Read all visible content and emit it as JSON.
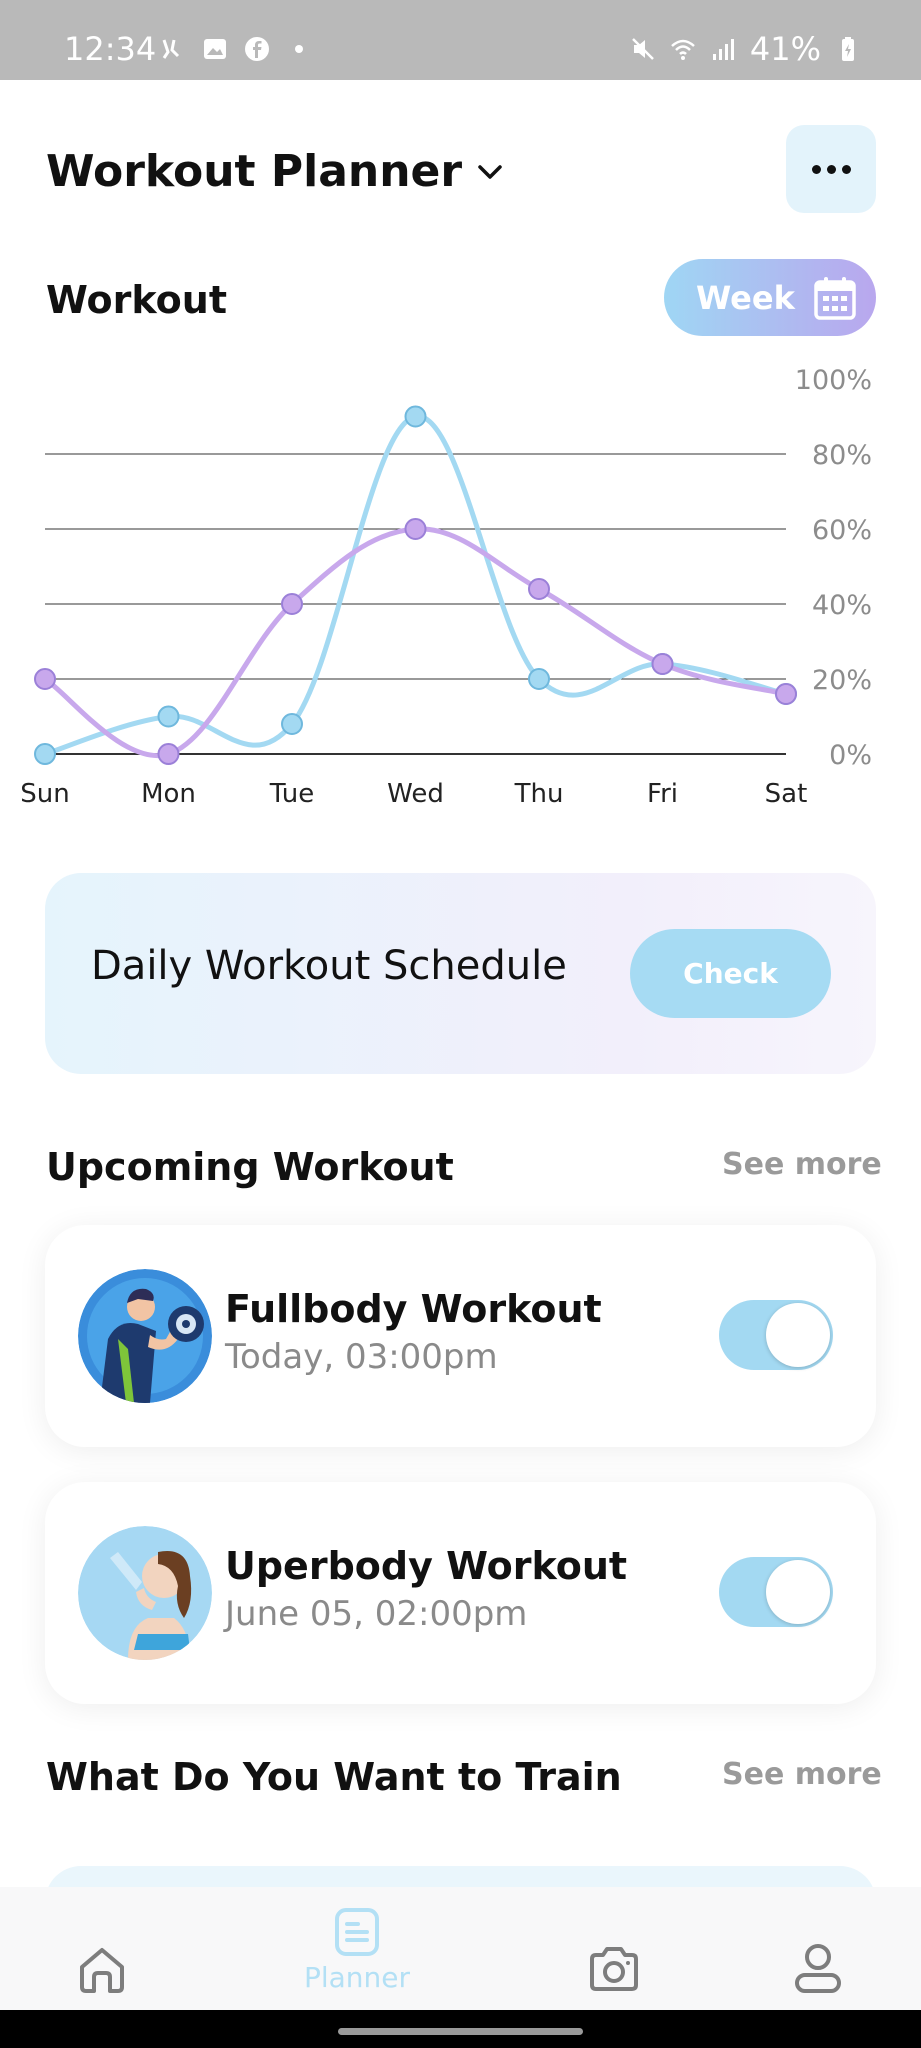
{
  "status_bar": {
    "time": "12:34",
    "battery": "41%"
  },
  "header": {
    "title": "Workout Planner"
  },
  "workout_section": {
    "title": "Workout",
    "period_button": "Week"
  },
  "chart_data": {
    "type": "line",
    "categories": [
      "Sun",
      "Mon",
      "Tue",
      "Wed",
      "Thu",
      "Fri",
      "Sat"
    ],
    "y_ticks": [
      "100%",
      "80%",
      "60%",
      "40%",
      "20%",
      "0%"
    ],
    "ylim": [
      0,
      100
    ],
    "series": [
      {
        "color": "#a3d9f2",
        "values": [
          0,
          10,
          8,
          90,
          20,
          24,
          16
        ]
      },
      {
        "color": "#c8a8ec",
        "values": [
          20,
          0,
          40,
          60,
          44,
          24,
          16
        ]
      }
    ]
  },
  "schedule_card": {
    "label": "Daily Workout Schedule",
    "button": "Check"
  },
  "upcoming": {
    "title": "Upcoming Workout",
    "see_more": "See more",
    "items": [
      {
        "title": "Fullbody Workout",
        "time": "Today, 03:00pm",
        "enabled": true
      },
      {
        "title": "Uperbody Workout",
        "time": "June 05, 02:00pm",
        "enabled": true
      }
    ]
  },
  "train": {
    "title": "What Do You Want to Train",
    "see_more": "See more"
  },
  "bottom_nav": {
    "planner_label": "Planner"
  }
}
